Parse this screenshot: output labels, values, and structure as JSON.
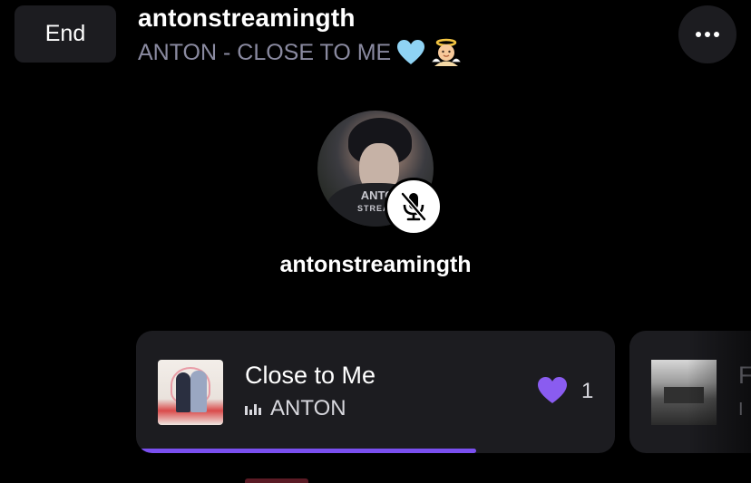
{
  "header": {
    "end_label": "End",
    "host_handle": "antonstreamingth",
    "stream_title": "ANTON - CLOSE TO ME",
    "emojis": [
      "light-blue-heart",
      "baby-angel"
    ]
  },
  "speaker": {
    "name": "antonstreamingth",
    "mic_status": "muted",
    "avatar_watermark_line1": "ANTO",
    "avatar_watermark_line2": "STREAM"
  },
  "now_playing": {
    "title": "Close to Me",
    "artist": "ANTON",
    "likes": "1",
    "progress": 0.71,
    "accent_color": "#7a4ff0"
  },
  "next_track": {
    "title_peek": "F",
    "sub_peek": "I"
  }
}
